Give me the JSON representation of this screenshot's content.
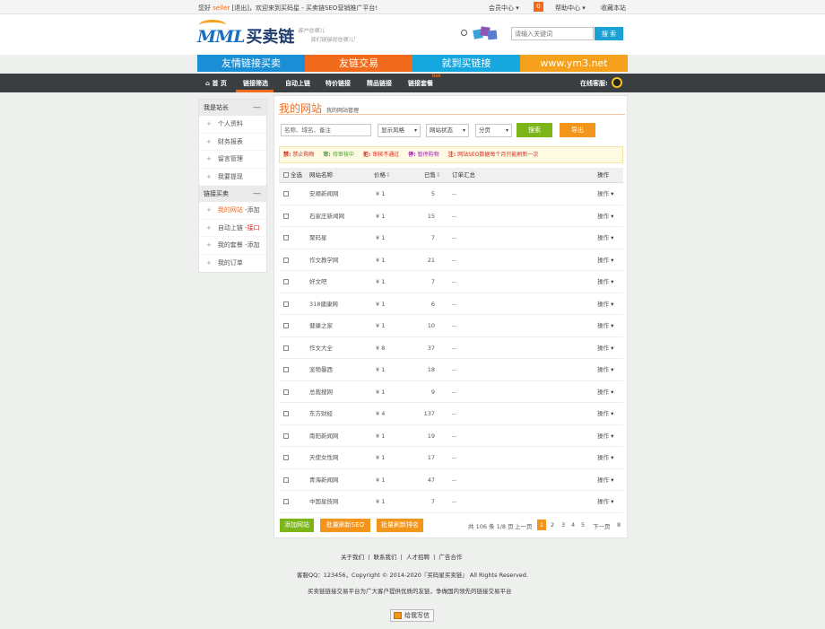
{
  "topbar": {
    "greet_prefix": "您好",
    "username": "seller",
    "logout": "[退出]",
    "welcome": "，欢迎来到买码星 - 买卖链SEO营销推广平台!",
    "member_center": "会员中心",
    "badge_count": "0",
    "help_center": "帮助中心",
    "bookmark": "收藏本站"
  },
  "header": {
    "logo_mark": "MML",
    "logo_name": "买卖链",
    "slogan_line1": "客户在哪儿",
    "slogan_line2": "我们链接就在哪儿!",
    "search_placeholder": "请输入关键词",
    "search_button": "搜 索"
  },
  "banners": [
    {
      "label": "友情链接买卖",
      "color": "#1a8fd6"
    },
    {
      "label": "友链交易",
      "color": "#f26b1d"
    },
    {
      "label": "就到买链接",
      "color": "#16a7de"
    },
    {
      "label": "www.ym3.net",
      "color": "#f6a11b"
    }
  ],
  "nav": {
    "items": [
      "首 页",
      "链接筛选",
      "自动上链",
      "特价链接",
      "精品链接",
      "链接套餐"
    ],
    "hot": "hot",
    "online_service": "在线客服:"
  },
  "sidebar": {
    "group1_title": "我是站长",
    "group1_items": [
      "个人资料",
      "财务报表",
      "留言管理",
      "我要提现"
    ],
    "group2_title": "链接买卖",
    "group2_items": [
      {
        "label": "我的网站",
        "extra": "-添加",
        "active": true,
        "extra_red": false
      },
      {
        "label": "自动上链",
        "extra": "-接口",
        "active": false,
        "extra_red": true
      },
      {
        "label": "我的套餐",
        "extra": "-添加",
        "active": false,
        "extra_red": false
      },
      {
        "label": "我的订单",
        "extra": "",
        "active": false,
        "extra_red": false
      }
    ]
  },
  "main": {
    "title": "我的网站",
    "subtitle": "我的网站管理",
    "filter_placeholder": "名称、域名、备注",
    "select_style": "显示风格",
    "select_status": "网站状态",
    "select_page": "分页",
    "search_button": "搜索",
    "export_button": "导出",
    "legend": [
      {
        "key": "禁:",
        "text": "禁止购物",
        "color": "#e0231d"
      },
      {
        "key": "审:",
        "text": "待审核中",
        "color": "#3aa021"
      },
      {
        "key": "拒:",
        "text": "审核不通过",
        "color": "#e0231d"
      },
      {
        "key": "停:",
        "text": "暂停购物",
        "color": "#9c27b0"
      },
      {
        "key": "注:",
        "text": "网站SEO数据每个月只能刷新一次",
        "color": "#e0231d"
      }
    ],
    "columns": {
      "select_all": "全选",
      "name": "网站名称",
      "price": "价格",
      "sold": "已售",
      "summary": "订单汇总",
      "action": "操作"
    },
    "rows": [
      {
        "name": "安顺新闻网",
        "price": "¥ 1",
        "sold": "5",
        "summary": "--",
        "action": "操作"
      },
      {
        "name": "石家庄新闻网",
        "price": "¥ 1",
        "sold": "15",
        "summary": "--",
        "action": "操作"
      },
      {
        "name": "聚码星",
        "price": "¥ 1",
        "sold": "7",
        "summary": "--",
        "action": "操作"
      },
      {
        "name": "作文教学网",
        "price": "¥ 1",
        "sold": "21",
        "summary": "--",
        "action": "操作"
      },
      {
        "name": "好文吧",
        "price": "¥ 1",
        "sold": "7",
        "summary": "--",
        "action": "操作"
      },
      {
        "name": "318健康网",
        "price": "¥ 1",
        "sold": "6",
        "summary": "--",
        "action": "操作"
      },
      {
        "name": "健康之家",
        "price": "¥ 1",
        "sold": "10",
        "summary": "--",
        "action": "操作"
      },
      {
        "name": "作文大全",
        "price": "¥ 8",
        "sold": "37",
        "summary": "--",
        "action": "操作"
      },
      {
        "name": "宠物暴西",
        "price": "¥ 1",
        "sold": "18",
        "summary": "--",
        "action": "操作"
      },
      {
        "name": "总裁搜网",
        "price": "¥ 1",
        "sold": "9",
        "summary": "--",
        "action": "操作"
      },
      {
        "name": "东方财经",
        "price": "¥ 4",
        "sold": "137",
        "summary": "--",
        "action": "操作"
      },
      {
        "name": "南阳新闻网",
        "price": "¥ 1",
        "sold": "19",
        "summary": "--",
        "action": "操作"
      },
      {
        "name": "天使女性网",
        "price": "¥ 1",
        "sold": "17",
        "summary": "--",
        "action": "操作"
      },
      {
        "name": "青海新闻网",
        "price": "¥ 1",
        "sold": "47",
        "summary": "--",
        "action": "操作"
      },
      {
        "name": "中国星技网",
        "price": "¥ 1",
        "sold": "7",
        "summary": "--",
        "action": "操作"
      }
    ],
    "btn_add": "添加网站",
    "btn_refresh_seo": "批量刷新SEO",
    "btn_refresh_rank": "批量刷新排名",
    "pager": {
      "total": "共 106 条 1/8 页",
      "prev": "上一页",
      "pages": [
        "1",
        "2",
        "3",
        "4",
        "5"
      ],
      "next": "下一页",
      "last": "8"
    }
  },
  "footer": {
    "links": [
      "关于我们",
      "联系我们",
      "人才招聘",
      "广告合作"
    ],
    "copyright": "客服QQ：123456，Copyright © 2014-2020『买码星买卖链』 All Rights Reserved.",
    "desc": "买卖链链接交易平台为广大客户提供优质的友链，争做国内领先的链接交易平台",
    "message_button": "给我写信"
  }
}
